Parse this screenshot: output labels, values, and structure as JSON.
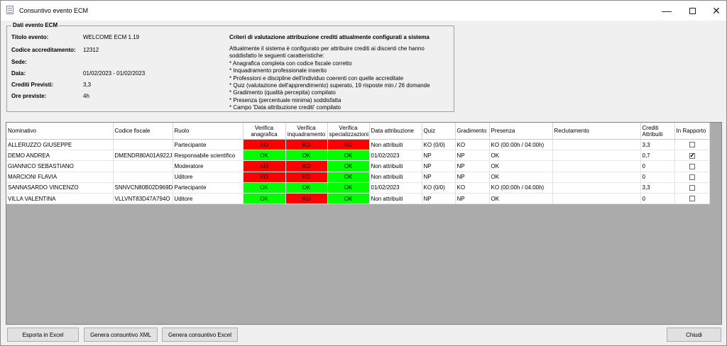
{
  "window": {
    "title": "Consuntivo evento ECM",
    "icon": "document-icon"
  },
  "event": {
    "group_title": "Dati evento ECM",
    "fields": [
      {
        "label": "Titolo evento:",
        "value": "WELCOME ECM 1.19"
      },
      {
        "label": "Codice accreditamento:",
        "value": "12312"
      },
      {
        "label": "Sede:",
        "value": ""
      },
      {
        "label": "Data:",
        "value": "01/02/2023 - 01/02/2023"
      },
      {
        "label": "Crediti Previsti:",
        "value": "3,3"
      },
      {
        "label": "Ore previste:",
        "value": "4h"
      }
    ],
    "criteria_title": "Criteri di valutazione attribuzione crediti attualmente configurati a sistema",
    "criteria_lines": [
      "Attualmente il sistema è configurato per attribuire crediti ai discenti che hanno",
      "soddisfatto le seguenti caratteristiche:",
      "* Anagrafica completa con codice fiscale corretto",
      "* Inquadramento professionale inserito",
      "* Professioni e discipline dell'individuo coerenti con quelle accreditate",
      "* Quiz (valutazione dell'apprendimento) superato, 19 risposte min./ 26 domande",
      "* Gradimento (qualità percepita) compilato",
      "* Presenza (percentuale minima) soddisfatta",
      "* Campo 'Data attribuzione crediti' compilato"
    ]
  },
  "table": {
    "headers": {
      "nominativo": "Nominativo",
      "cf": "Codice fiscale",
      "ruolo": "Ruolo",
      "v_anag": "Verifica anagrafica",
      "v_inq": "Verifica inquadramento",
      "v_spec": "Verifica specializzazioni",
      "data_attr": "Data attribuzione",
      "quiz": "Quiz",
      "grad": "Gradimento",
      "presenza": "Presenza",
      "recl": "Reclutamento",
      "crediti": "Crediti Attribuiti",
      "rapporto": "In Rapporto"
    },
    "rows": [
      {
        "nominativo": "ALLERUZZO GIUSEPPE",
        "cf": "",
        "ruolo": "Partecipante",
        "v_anag": "KO",
        "v_inq": "KO",
        "v_spec": "KO",
        "data_attr": "Non attribuiti",
        "quiz": "KO (0/0)",
        "grad": "KO",
        "presenza": "KO (00:00h / 04:00h)",
        "recl": "",
        "crediti": "3,3",
        "rapporto": false
      },
      {
        "nominativo": "DEMO ANDREA",
        "cf": "DMENDR80A01A922J",
        "ruolo": "Responsabile scientifico",
        "v_anag": "OK",
        "v_inq": "OK",
        "v_spec": "OK",
        "data_attr": "01/02/2023",
        "quiz": "NP",
        "grad": "NP",
        "presenza": "OK",
        "recl": "",
        "crediti": "0,7",
        "rapporto": true
      },
      {
        "nominativo": "GIANNICO SEBASTIANO",
        "cf": "",
        "ruolo": "Moderatore",
        "v_anag": "KO",
        "v_inq": "KO",
        "v_spec": "OK",
        "data_attr": "Non attribuiti",
        "quiz": "NP",
        "grad": "NP",
        "presenza": "OK",
        "recl": "",
        "crediti": "0",
        "rapporto": false
      },
      {
        "nominativo": "MARCIONI FLAVIA",
        "cf": "",
        "ruolo": "Uditore",
        "v_anag": "KO",
        "v_inq": "KO",
        "v_spec": "OK",
        "data_attr": "Non attribuiti",
        "quiz": "NP",
        "grad": "NP",
        "presenza": "OK",
        "recl": "",
        "crediti": "0",
        "rapporto": false
      },
      {
        "nominativo": "SANNASARDO VINCENZO",
        "cf": "SNNVCN80B02D969D",
        "ruolo": "Partecipante",
        "v_anag": "OK",
        "v_inq": "OK",
        "v_spec": "OK",
        "data_attr": "01/02/2023",
        "quiz": "KO (0/0)",
        "grad": "KO",
        "presenza": "KO (00:00h / 04:00h)",
        "recl": "",
        "crediti": "3,3",
        "rapporto": false
      },
      {
        "nominativo": "VILLA VALENTINA",
        "cf": "VLLVNT83D47A794O",
        "ruolo": "Uditore",
        "v_anag": "OK",
        "v_inq": "KO",
        "v_spec": "OK",
        "data_attr": "Non attribuiti",
        "quiz": "NP",
        "grad": "NP",
        "presenza": "OK",
        "recl": "",
        "crediti": "0",
        "rapporto": false
      }
    ]
  },
  "buttons": {
    "esporta": "Esporta in Excel",
    "xml": "Genera consuntivo XML",
    "excel": "Genera consuntivo Excel",
    "chiudi": "Chiudi"
  },
  "colors": {
    "ok": "#00ff00",
    "ko": "#ff0000",
    "grid_bg": "#ababab"
  }
}
